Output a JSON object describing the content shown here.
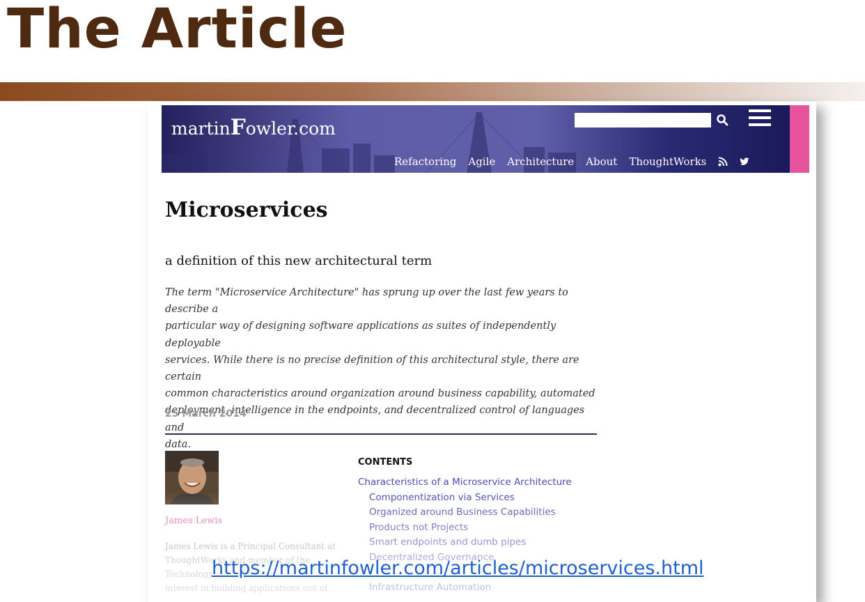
{
  "slide": {
    "title": "The Article",
    "url": "https://martinfowler.com/articles/microservices.html"
  },
  "site": {
    "logo_prefix": "martin",
    "logo_big": "F",
    "logo_suffix": "owler.com",
    "search_placeholder": "",
    "nav": [
      "Refactoring",
      "Agile",
      "Architecture",
      "About",
      "ThoughtWorks"
    ],
    "icons": [
      "search-icon",
      "menu-icon",
      "rss-icon",
      "twitter-icon"
    ],
    "header_color": "#24215e",
    "accent_color": "#e8539e"
  },
  "article": {
    "title": "Microservices",
    "subtitle": "a definition of this new architectural term",
    "abstract": [
      "The term \"Microservice Architecture\" has sprung up over the last few years to describe a",
      "particular way of designing software applications as suites of independently deployable",
      "services. While there is no precise definition of this architectural style, there are certain",
      "common characteristics around organization around business capability, automated",
      "deployment, intelligence in the endpoints, and decentralized control of languages and",
      "data."
    ],
    "date": "25 March 2014"
  },
  "author": {
    "name": "James Lewis",
    "bio": [
      "James Lewis is a Principal Consultant at",
      "ThoughtWorks and member of the",
      "Technology",
      "interest in building applications out of"
    ]
  },
  "contents": {
    "heading": "CONTENTS",
    "items": [
      {
        "label": "Characteristics of a Microservice Architecture",
        "level": 0
      },
      {
        "label": "Componentization via Services",
        "level": 1
      },
      {
        "label": "Organized around Business Capabilities",
        "level": 1
      },
      {
        "label": "Products not Projects",
        "level": 1
      },
      {
        "label": "Smart endpoints and dumb pipes",
        "level": 1
      },
      {
        "label": "Decentralized Governance",
        "level": 1
      },
      {
        "label": "",
        "level": 1
      },
      {
        "label": "Infrastructure Automation",
        "level": 1
      }
    ]
  }
}
